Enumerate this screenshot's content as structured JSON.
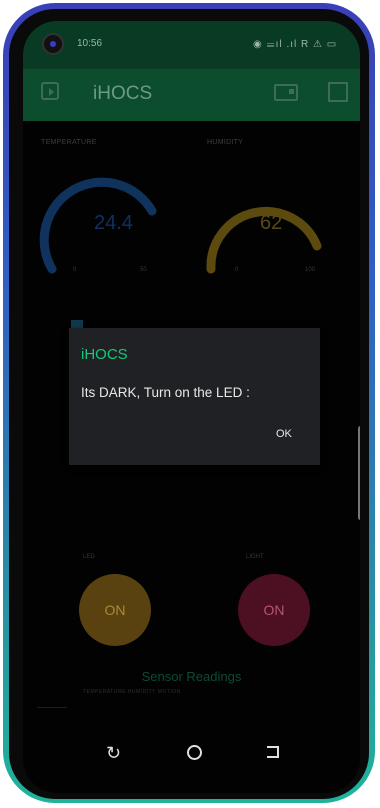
{
  "status_bar": {
    "time": "10:56",
    "icons": "◉ 𝍢ıl .ıl R ⚠ ▭"
  },
  "app_bar": {
    "title": "iHOCS"
  },
  "gauges": [
    {
      "label": "TEMPERATURE",
      "value": "24.4",
      "color": "#10335e",
      "min_label": "0",
      "max_label": "50"
    },
    {
      "label": "HUMIDITY",
      "value": "62",
      "color": "#5c4a0f",
      "min_label": "0",
      "max_label": "100"
    }
  ],
  "dialog": {
    "title": "iHOCS",
    "message": "Its DARK, Turn on the LED :",
    "ok_label": "OK"
  },
  "buttons": [
    {
      "label": "LED",
      "state_label": "ON",
      "color": "#5a4210"
    },
    {
      "label": "LIGHT",
      "state_label": "ON",
      "color": "#4d0f22"
    }
  ],
  "readings": {
    "title": "Sensor Readings",
    "legend": "TEMPERATURE   HUMIDITY   MOTION"
  },
  "colors": {
    "status_bar": "#093a23",
    "app_bar": "#0c4d2e",
    "dialog_accent": "#14c97a"
  },
  "icons": [
    "back-icon",
    "board-icon",
    "square-icon",
    "recent-apps-icon",
    "home-icon",
    "back-nav-icon"
  ]
}
